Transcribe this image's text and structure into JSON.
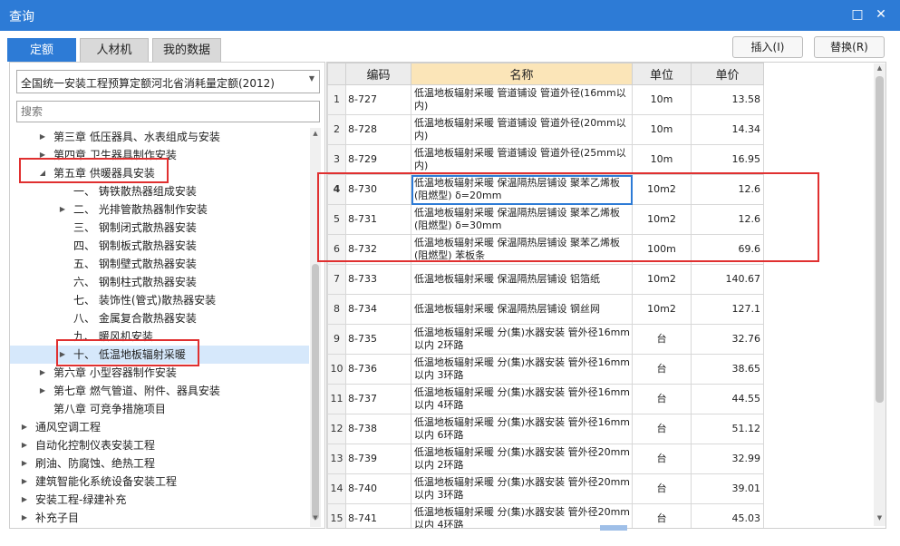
{
  "window": {
    "title": "查询",
    "maximize_icon": "maximize-icon",
    "close_icon": "close-icon"
  },
  "tabs": [
    {
      "label": "定额",
      "active": true
    },
    {
      "label": "人材机",
      "active": false
    },
    {
      "label": "我的数据",
      "active": false
    }
  ],
  "buttons": {
    "insert": "插入(I)",
    "replace": "替换(R)"
  },
  "quota_library": {
    "selected": "全国统一安装工程预算定额河北省消耗量定额(2012)"
  },
  "search": {
    "placeholder": "搜索",
    "value": ""
  },
  "tree": [
    {
      "label": "第三章 低压器具、水表组成与安装",
      "level": 1,
      "toggle": "collapsed"
    },
    {
      "label": "第四章 卫生器具制作安装",
      "level": 1,
      "toggle": "collapsed"
    },
    {
      "label": "第五章 供暖器具安装",
      "level": 1,
      "toggle": "expanded"
    },
    {
      "label": "一、 铸铁散热器组成安装",
      "level": 2,
      "toggle": "none"
    },
    {
      "label": "二、 光排管散热器制作安装",
      "level": 2,
      "toggle": "collapsed"
    },
    {
      "label": "三、 钢制闭式散热器安装",
      "level": 2,
      "toggle": "none"
    },
    {
      "label": "四、 钢制板式散热器安装",
      "level": 2,
      "toggle": "none"
    },
    {
      "label": "五、 钢制壁式散热器安装",
      "level": 2,
      "toggle": "none"
    },
    {
      "label": "六、 钢制柱式散热器安装",
      "level": 2,
      "toggle": "none"
    },
    {
      "label": "七、 装饰性(管式)散热器安装",
      "level": 2,
      "toggle": "none"
    },
    {
      "label": "八、 金属复合散热器安装",
      "level": 2,
      "toggle": "none"
    },
    {
      "label": "九、 暖风机安装",
      "level": 2,
      "toggle": "none"
    },
    {
      "label": "十、 低温地板辐射采暖",
      "level": 2,
      "toggle": "collapsed",
      "selected": true
    },
    {
      "label": "第六章 小型容器制作安装",
      "level": 1,
      "toggle": "collapsed"
    },
    {
      "label": "第七章 燃气管道、附件、器具安装",
      "level": 1,
      "toggle": "collapsed"
    },
    {
      "label": "第八章 可竞争措施项目",
      "level": 1,
      "toggle": "none"
    },
    {
      "label": "通风空调工程",
      "level": 0,
      "toggle": "collapsed"
    },
    {
      "label": "自动化控制仪表安装工程",
      "level": 0,
      "toggle": "collapsed"
    },
    {
      "label": "刷油、防腐蚀、绝热工程",
      "level": 0,
      "toggle": "collapsed"
    },
    {
      "label": "建筑智能化系统设备安装工程",
      "level": 0,
      "toggle": "collapsed"
    },
    {
      "label": "安装工程-绿建补充",
      "level": 0,
      "toggle": "collapsed"
    },
    {
      "label": "补充子目",
      "level": 0,
      "toggle": "collapsed"
    }
  ],
  "grid": {
    "headers": {
      "code": "编码",
      "name": "名称",
      "unit": "单位",
      "price": "单价"
    },
    "rows": [
      {
        "idx": "1",
        "code": "8-727",
        "name": "低温地板辐射采暖 管道铺设 管道外径(16mm以内)",
        "unit": "10m",
        "price": "13.58"
      },
      {
        "idx": "2",
        "code": "8-728",
        "name": "低温地板辐射采暖 管道铺设 管道外径(20mm以内)",
        "unit": "10m",
        "price": "14.34"
      },
      {
        "idx": "3",
        "code": "8-729",
        "name": "低温地板辐射采暖 管道铺设 管道外径(25mm以内)",
        "unit": "10m",
        "price": "16.95"
      },
      {
        "idx": "4",
        "code": "8-730",
        "name": "低温地板辐射采暖 保温隔热层铺设 聚苯乙烯板(阻燃型) δ=20mm",
        "unit": "10m2",
        "price": "12.6",
        "current": true
      },
      {
        "idx": "5",
        "code": "8-731",
        "name": "低温地板辐射采暖 保温隔热层铺设 聚苯乙烯板(阻燃型) δ=30mm",
        "unit": "10m2",
        "price": "12.6"
      },
      {
        "idx": "6",
        "code": "8-732",
        "name": "低温地板辐射采暖 保温隔热层铺设 聚苯乙烯板(阻燃型) 苯板条",
        "unit": "100m",
        "price": "69.6"
      },
      {
        "idx": "7",
        "code": "8-733",
        "name": "低温地板辐射采暖 保温隔热层铺设 铝箔纸",
        "unit": "10m2",
        "price": "140.67"
      },
      {
        "idx": "8",
        "code": "8-734",
        "name": "低温地板辐射采暖 保温隔热层铺设 钢丝网",
        "unit": "10m2",
        "price": "127.1"
      },
      {
        "idx": "9",
        "code": "8-735",
        "name": "低温地板辐射采暖 分(集)水器安装 管外径16mm以内 2环路",
        "unit": "台",
        "price": "32.76"
      },
      {
        "idx": "10",
        "code": "8-736",
        "name": "低温地板辐射采暖 分(集)水器安装 管外径16mm以内 3环路",
        "unit": "台",
        "price": "38.65"
      },
      {
        "idx": "11",
        "code": "8-737",
        "name": "低温地板辐射采暖 分(集)水器安装 管外径16mm以内 4环路",
        "unit": "台",
        "price": "44.55"
      },
      {
        "idx": "12",
        "code": "8-738",
        "name": "低温地板辐射采暖 分(集)水器安装 管外径16mm以内 6环路",
        "unit": "台",
        "price": "51.12"
      },
      {
        "idx": "13",
        "code": "8-739",
        "name": "低温地板辐射采暖 分(集)水器安装 管外径20mm以内 2环路",
        "unit": "台",
        "price": "32.99"
      },
      {
        "idx": "14",
        "code": "8-740",
        "name": "低温地板辐射采暖 分(集)水器安装 管外径20mm以内 3环路",
        "unit": "台",
        "price": "39.01"
      },
      {
        "idx": "15",
        "code": "8-741",
        "name": "低温地板辐射采暖 分(集)水器安装 管外径20mm以内 4环路",
        "unit": "台",
        "price": "45.03"
      },
      {
        "idx": "",
        "code": "",
        "name": "低温地板辐射采暖 分(集)水器安装 管外径",
        "unit": "",
        "price": ""
      }
    ]
  },
  "colors": {
    "accent": "#2d7bd6",
    "highlight_box": "#e03030",
    "header_highlight": "#fbe5b8",
    "selected_row": "#d6e8fb"
  }
}
